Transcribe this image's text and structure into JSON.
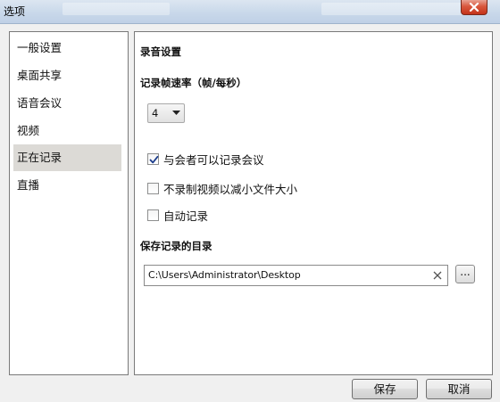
{
  "window": {
    "title": "选项"
  },
  "sidebar": {
    "items": [
      {
        "label": "一般设置"
      },
      {
        "label": "桌面共享"
      },
      {
        "label": "语音会议"
      },
      {
        "label": "视频"
      },
      {
        "label": "正在记录",
        "selected": true
      },
      {
        "label": "直播"
      }
    ]
  },
  "recording": {
    "section_title": "录音设置",
    "frame_rate_label": "记录帧速率（帧/每秒）",
    "frame_rate_value": "4",
    "options": [
      {
        "label": "与会者可以记录会议",
        "checked": true
      },
      {
        "label": "不录制视频以减小文件大小",
        "checked": false
      },
      {
        "label": "自动记录",
        "checked": false
      }
    ],
    "save_dir_label": "保存记录的目录",
    "save_dir_value": "C:\\Users\\Administrator\\Desktop",
    "browse_label": "..."
  },
  "footer": {
    "save_label": "保存",
    "cancel_label": "取消"
  },
  "colors": {
    "selected_item_bg": "#dcdad6",
    "close_button": "#c3331a",
    "checkmark": "#1c3d8c"
  },
  "icons": {
    "close": "close-icon",
    "dropdown": "chevron-down-icon",
    "clear": "clear-x-icon",
    "check": "checkmark-icon"
  }
}
